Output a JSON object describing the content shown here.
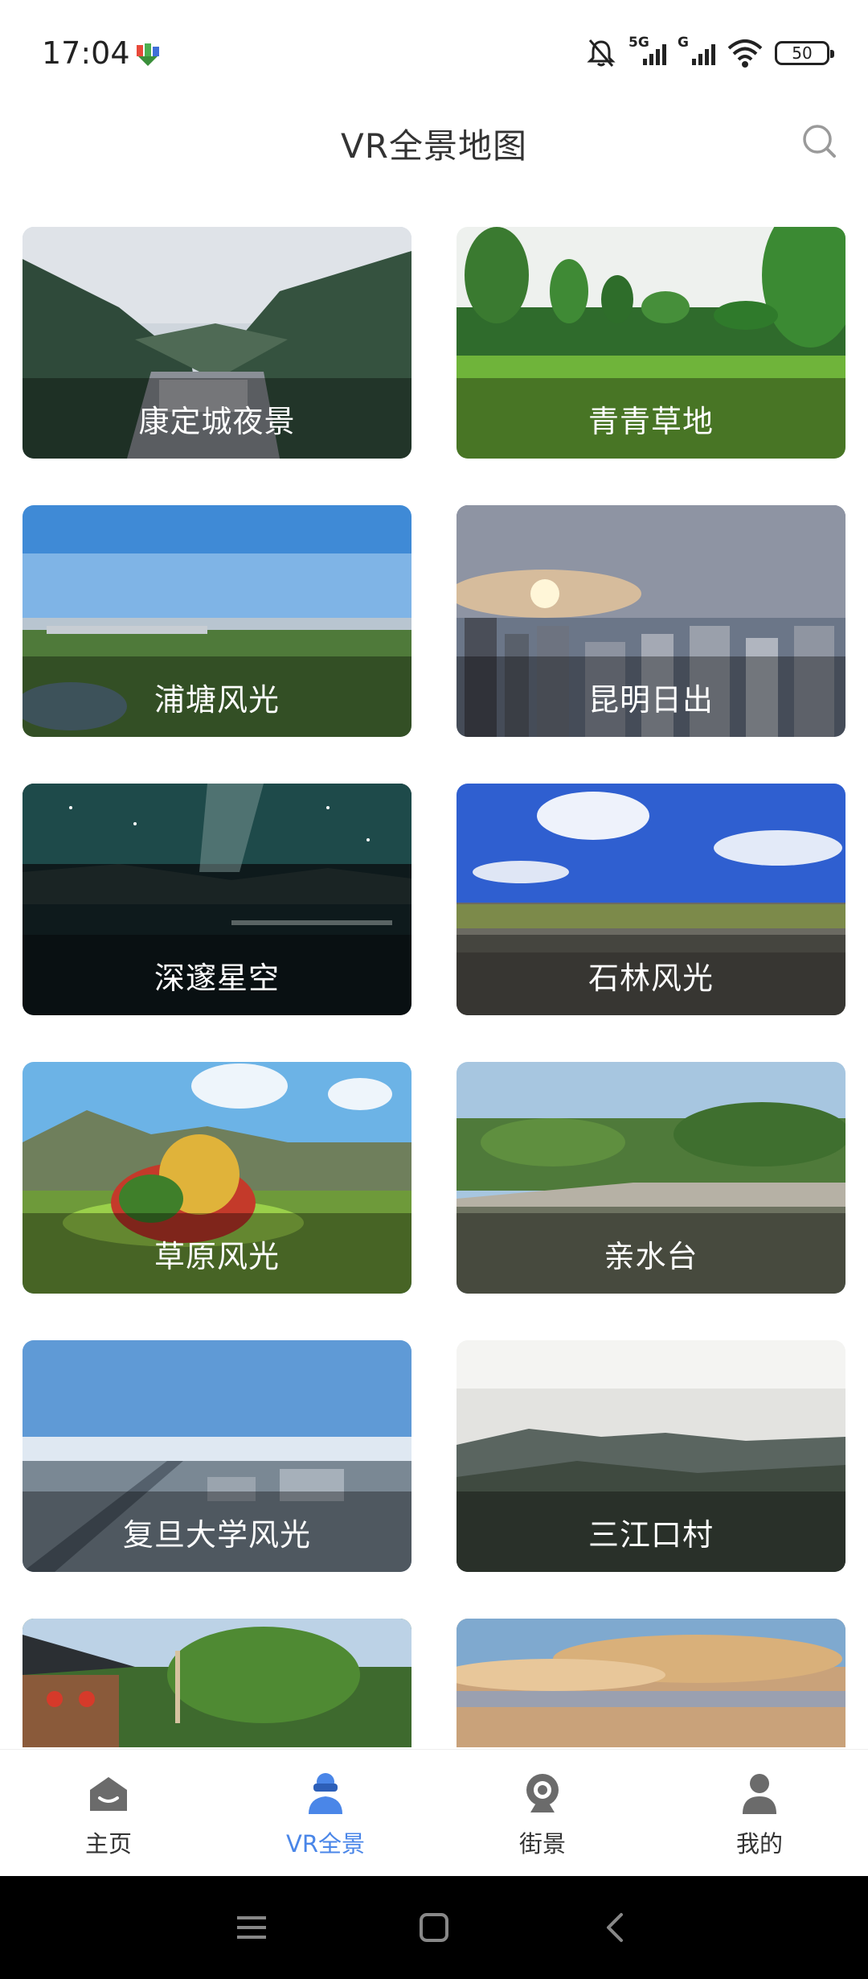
{
  "status_bar": {
    "time": "17:04",
    "signal1_label": "5G",
    "signal2_label": "G",
    "battery": "50",
    "icons": [
      "app-notification-icon",
      "bell-muted-icon",
      "signal-icon",
      "wifi-icon",
      "battery-icon"
    ]
  },
  "header": {
    "title": "VR全景地图",
    "search_icon": "search-icon"
  },
  "cards": [
    {
      "label": "康定城夜景"
    },
    {
      "label": "青青草地"
    },
    {
      "label": "浦塘风光"
    },
    {
      "label": "昆明日出"
    },
    {
      "label": "深邃星空"
    },
    {
      "label": "石林风光"
    },
    {
      "label": "草原风光"
    },
    {
      "label": "亲水台"
    },
    {
      "label": "复旦大学风光"
    },
    {
      "label": "三江口村"
    },
    {
      "label": ""
    },
    {
      "label": ""
    }
  ],
  "tabs": [
    {
      "label": "主页",
      "icon": "home-icon"
    },
    {
      "label": "VR全景",
      "icon": "vr-icon",
      "active": true
    },
    {
      "label": "街景",
      "icon": "camera-icon"
    },
    {
      "label": "我的",
      "icon": "user-icon"
    }
  ],
  "colors": {
    "accent": "#4a86e8",
    "tab_icon": "#666666"
  }
}
